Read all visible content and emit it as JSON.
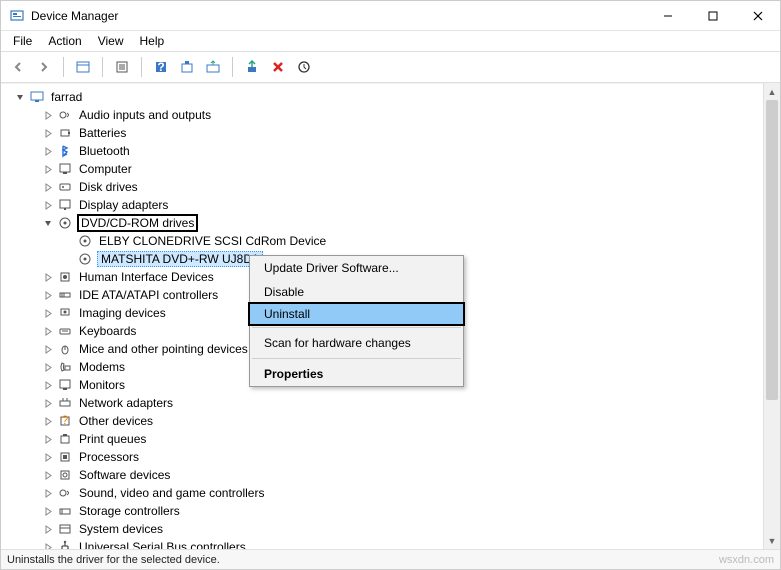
{
  "window": {
    "title": "Device Manager"
  },
  "menu": {
    "file": "File",
    "action": "Action",
    "view": "View",
    "help": "Help"
  },
  "tree": {
    "root": "farrad",
    "nodes": [
      "Audio inputs and outputs",
      "Batteries",
      "Bluetooth",
      "Computer",
      "Disk drives",
      "Display adapters",
      "DVD/CD-ROM drives",
      "Human Interface Devices",
      "IDE ATA/ATAPI controllers",
      "Imaging devices",
      "Keyboards",
      "Mice and other pointing devices",
      "Modems",
      "Monitors",
      "Network adapters",
      "Other devices",
      "Print queues",
      "Processors",
      "Software devices",
      "Sound, video and game controllers",
      "Storage controllers",
      "System devices",
      "Universal Serial Bus controllers"
    ],
    "dvd_children": [
      "ELBY CLONEDRIVE SCSI CdRom Device",
      "MATSHITA DVD+-RW UJ8D1"
    ]
  },
  "context_menu": {
    "update": "Update Driver Software...",
    "disable": "Disable",
    "uninstall": "Uninstall",
    "scan": "Scan for hardware changes",
    "properties": "Properties"
  },
  "statusbar": {
    "text": "Uninstalls the driver for the selected device.",
    "watermark": "wsxdn.com"
  }
}
